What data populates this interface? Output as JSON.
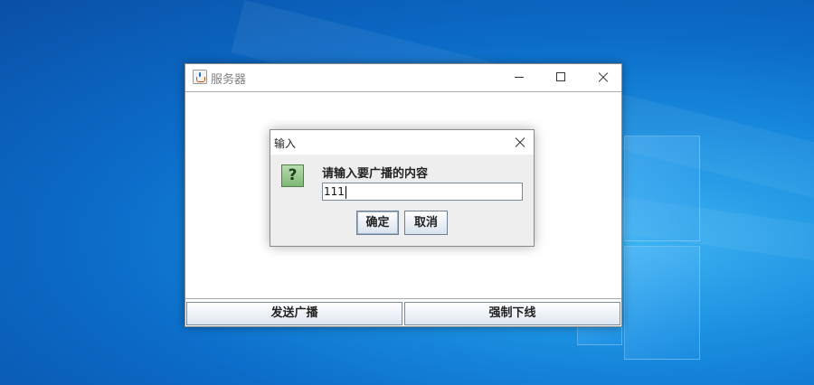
{
  "main_window": {
    "title": "服务器",
    "buttons": {
      "broadcast_label": "发送广播",
      "force_offline_label": "强制下线"
    }
  },
  "dialog": {
    "title": "输入",
    "prompt": "请输入要广播的内容",
    "input_value": "111",
    "ok_label": "确定",
    "cancel_label": "取消",
    "icon": "question-icon"
  },
  "colors": {
    "desktop": "#0b6cc8",
    "dialog_bg": "#eeeeee",
    "question_icon": "#7fb877"
  }
}
